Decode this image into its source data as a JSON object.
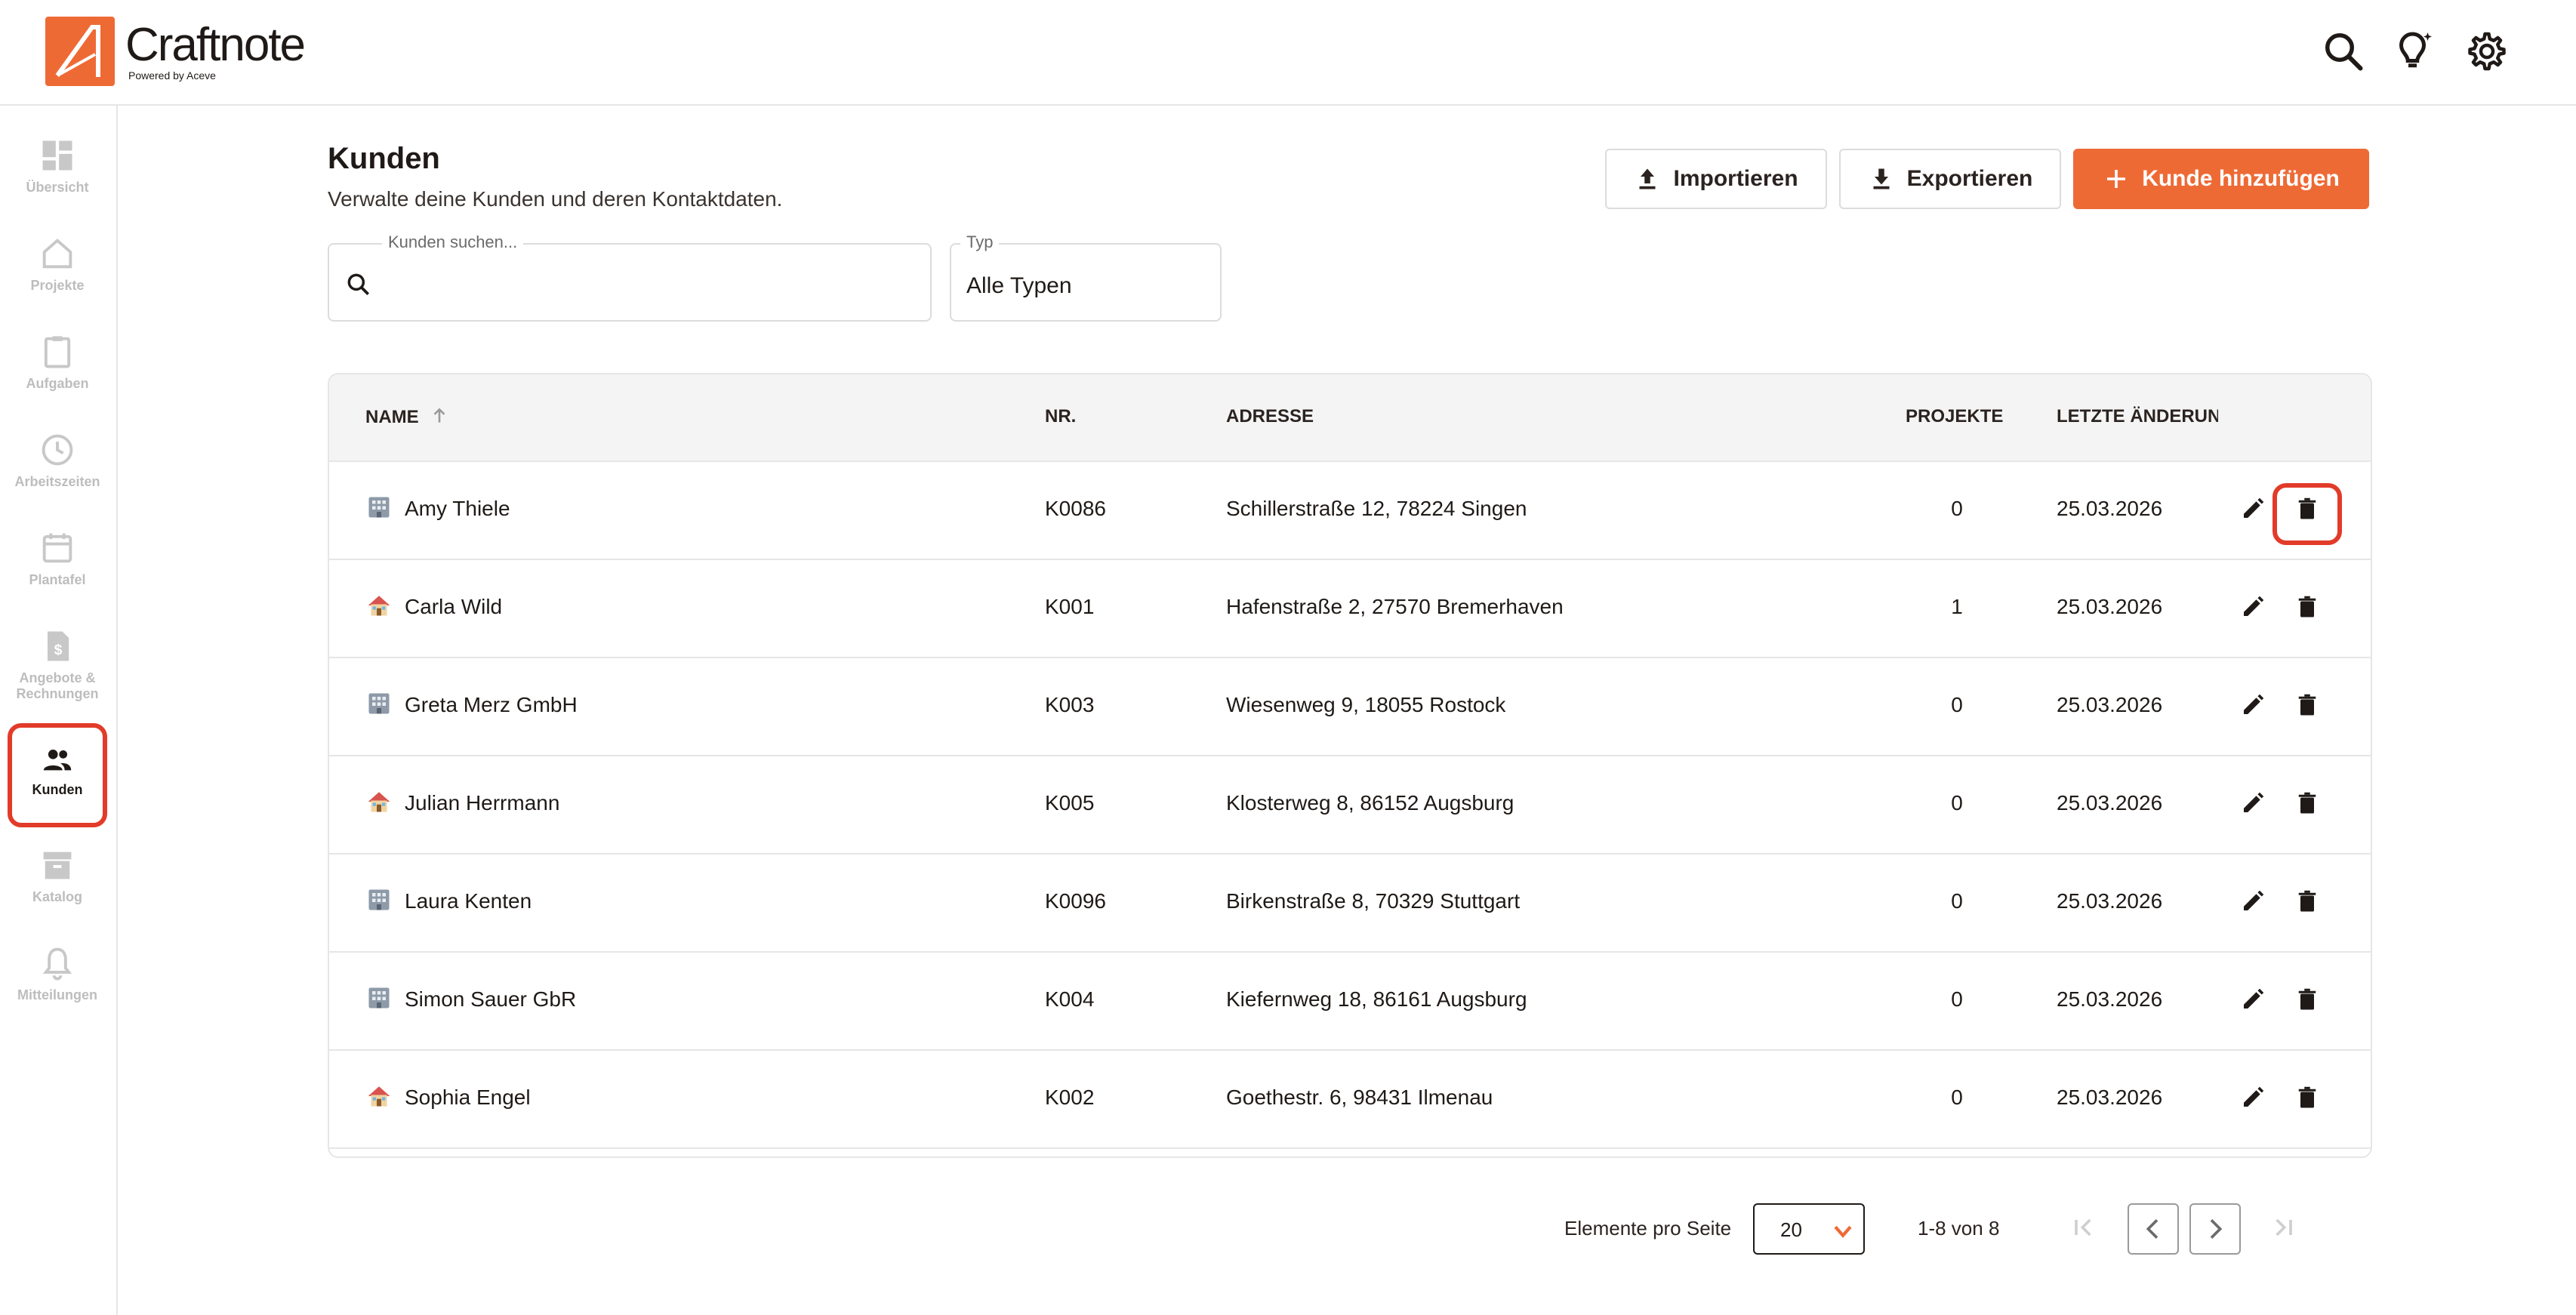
{
  "app": {
    "name": "Craftnote",
    "tagline": "Powered by Aceve",
    "accent": "#ee6a35",
    "highlight": "#e23b2a"
  },
  "header": {
    "icons": [
      "search-icon",
      "lightbulb-icon",
      "gear-icon"
    ]
  },
  "sidebar": {
    "items": [
      {
        "label": "Übersicht",
        "icon": "dashboard-icon"
      },
      {
        "label": "Projekte",
        "icon": "home-icon"
      },
      {
        "label": "Aufgaben",
        "icon": "clipboard-icon"
      },
      {
        "label": "Arbeitszeiten",
        "icon": "clock-icon"
      },
      {
        "label": "Plantafel",
        "icon": "calendar-icon"
      },
      {
        "label": "Angebote & Rechnungen",
        "icon": "invoice-icon"
      },
      {
        "label": "Kunden",
        "icon": "people-icon",
        "active": true
      },
      {
        "label": "Katalog",
        "icon": "archive-icon"
      },
      {
        "label": "Mitteilungen",
        "icon": "bell-icon"
      }
    ]
  },
  "page": {
    "title": "Kunden",
    "subtitle": "Verwalte deine Kunden und deren Kontaktdaten.",
    "buttons": {
      "import": "Importieren",
      "export": "Exportieren",
      "add": "Kunde hinzufügen"
    },
    "search": {
      "label": "Kunden suchen...",
      "value": ""
    },
    "type_filter": {
      "label": "Typ",
      "value": "Alle Typen"
    }
  },
  "table": {
    "columns": {
      "name": "NAME",
      "nr": "NR.",
      "address": "ADRESSE",
      "projects": "PROJEKTE",
      "changed": "LETZTE ÄNDERUN"
    },
    "sort": {
      "column": "name",
      "direction": "asc"
    },
    "rows": [
      {
        "type": "company",
        "name": "Amy Thiele",
        "nr": "K0086",
        "address": "Schillerstraße 12, 78224 Singen",
        "projects": "0",
        "changed": "25.03.2026"
      },
      {
        "type": "private",
        "name": "Carla Wild",
        "nr": "K001",
        "address": "Hafenstraße 2, 27570 Bremerhaven",
        "projects": "1",
        "changed": "25.03.2026"
      },
      {
        "type": "company",
        "name": "Greta Merz GmbH",
        "nr": "K003",
        "address": "Wiesenweg 9, 18055 Rostock",
        "projects": "0",
        "changed": "25.03.2026"
      },
      {
        "type": "private",
        "name": "Julian Herrmann",
        "nr": "K005",
        "address": "Klosterweg 8, 86152 Augsburg",
        "projects": "0",
        "changed": "25.03.2026"
      },
      {
        "type": "company",
        "name": "Laura Kenten",
        "nr": "K0096",
        "address": "Birkenstraße 8, 70329 Stuttgart",
        "projects": "0",
        "changed": "25.03.2026"
      },
      {
        "type": "company",
        "name": "Simon Sauer GbR",
        "nr": "K004",
        "address": "Kiefernweg 18, 86161 Augsburg",
        "projects": "0",
        "changed": "25.03.2026"
      },
      {
        "type": "private",
        "name": "Sophia Engel",
        "nr": "K002",
        "address": "Goethestr. 6, 98431 Ilmenau",
        "projects": "0",
        "changed": "25.03.2026"
      }
    ]
  },
  "pagination": {
    "label": "Elemente pro Seite",
    "per_page": "20",
    "range": "1-8 von 8"
  }
}
